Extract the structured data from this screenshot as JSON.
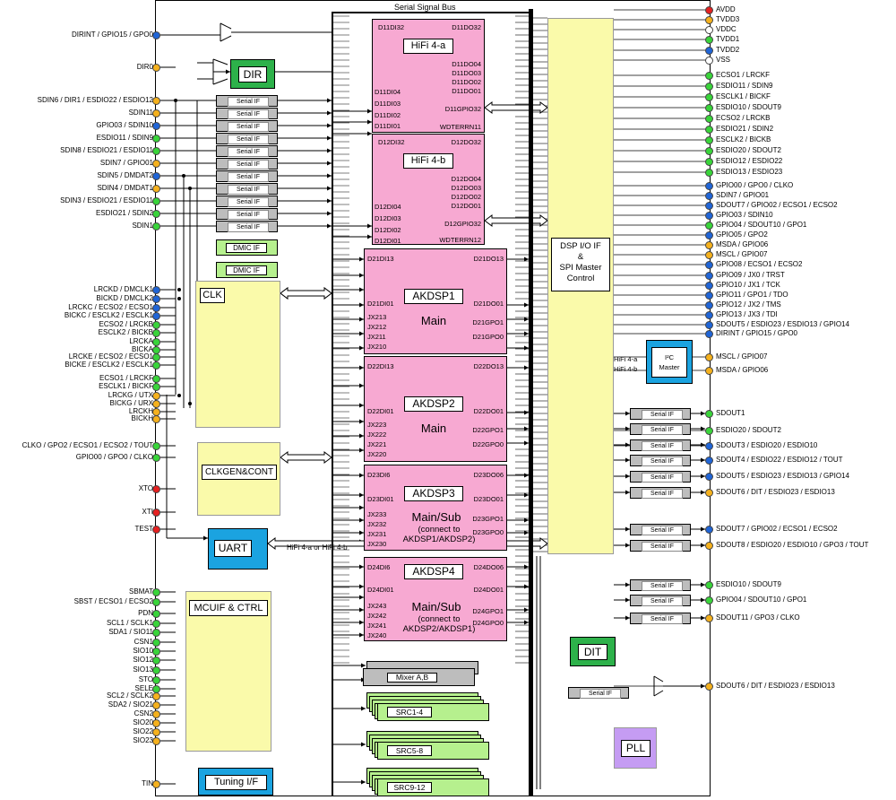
{
  "colors": {
    "hifi": "#f7a9d2",
    "yellow": "#fafaaa",
    "green": "#2db14a",
    "light_green": "#b6f08e",
    "blue": "#1ba3e0",
    "purple": "#c59cf3",
    "gray": "#bdbdbd",
    "pin_green": "#39d43a",
    "pin_blue": "#2065d6",
    "pin_orange": "#f5b11d",
    "pin_red": "#e52121",
    "pin_white": "#ffffff"
  },
  "bus_label": "Serial Signal Bus",
  "blocks": {
    "dir": "DIR",
    "dit": "DIT",
    "clk": "CLK",
    "clkgen": "CLKGEN&CONT",
    "uart": "UART",
    "mcuif": "MCUIF & CTRL",
    "tuning": "Tuning I/F",
    "pll": "PLL",
    "dsp_io": "DSP I/O IF\n&\nSPI Master\nControl",
    "i2c_master": "I²C\nMaster",
    "mixer": "Mixer A,B",
    "src1": "SRC1-4",
    "src2": "SRC5-8",
    "src3": "SRC9-12",
    "dmic_if": "DMIC IF",
    "serial_if": "Serial IF",
    "hifi_label": "HiFi 4-a\nHiFi 4-b",
    "uart_bus_label": "HiFi 4-a or HiFi 4-b"
  },
  "hifi_a": {
    "title": "HiFi 4-a",
    "di_top": "D11DI32",
    "do_top": "D11DO32",
    "di": [
      "D11DI04",
      "D11DI03",
      "D11DI02",
      "D11DI01"
    ],
    "do": [
      "D11DO04",
      "D11DO03",
      "D11DO02",
      "D11DO01"
    ],
    "gpio": "D11GPIO32",
    "wdt": "WDTERRN11"
  },
  "hifi_b": {
    "title": "HiFi 4-b",
    "di_top": "D12DI32",
    "do_top": "D12DO32",
    "di": [
      "D12DI04",
      "D12DI03",
      "D12DI02",
      "D12DI01"
    ],
    "do": [
      "D12DO04",
      "D12DO03",
      "D12DO02",
      "D12DO01"
    ],
    "gpio": "D12GPIO32",
    "wdt": "WDTERRN12"
  },
  "dsp1": {
    "title": "AKDSP1",
    "mode": "Main",
    "sub": "",
    "di_top": "D21DI13",
    "do_top": "D21DO13",
    "di1": "D21DI01",
    "do1": "D21DO01",
    "jx": [
      "JX213",
      "JX212",
      "JX211",
      "JX210"
    ],
    "gpo": [
      "D21GPO1",
      "D21GPO0"
    ]
  },
  "dsp2": {
    "title": "AKDSP2",
    "mode": "Main",
    "sub": "",
    "di_top": "D22DI13",
    "do_top": "D22DO13",
    "di1": "D22DI01",
    "do1": "D22DO01",
    "jx": [
      "JX223",
      "JX222",
      "JX221",
      "JX220"
    ],
    "gpo": [
      "D22GPO1",
      "D22GPO0"
    ]
  },
  "dsp3": {
    "title": "AKDSP3",
    "mode": "Main/Sub",
    "sub": "(connect to\nAKDSP1/AKDSP2)",
    "di_top": "D23DI6",
    "do_top": "D23DO06",
    "di1": "D23DI01",
    "do1": "D23DO01",
    "jx": [
      "JX233",
      "JX232",
      "JX231",
      "JX230"
    ],
    "gpo": [
      "D23GPO1",
      "D23GPO0"
    ]
  },
  "dsp4": {
    "title": "AKDSP4",
    "mode": "Main/Sub",
    "sub": "(connect to\nAKDSP2/AKDSP1)",
    "di_top": "D24DI6",
    "do_top": "D24DO06",
    "di1": "D24DI01",
    "do1": "D24DO01",
    "jx": [
      "JX243",
      "JX242",
      "JX241",
      "JX240"
    ],
    "gpo": [
      "D24GPO1",
      "D24GPO0"
    ]
  },
  "left_pins": [
    {
      "label": "DIRINT / GPIO15 / GPO0",
      "color": "blue"
    },
    {
      "label": "DIR0",
      "color": "orange"
    },
    {
      "label": "SDIN6 / DIR1 / ESDIO22 / ESDIO12",
      "color": "orange"
    },
    {
      "label": "SDIN11",
      "color": "orange"
    },
    {
      "label": "GPIO03 / SDIN10",
      "color": "blue"
    },
    {
      "label": "ESDIO11 / SDIN9",
      "color": "green"
    },
    {
      "label": "SDIN8 / ESDIO21 / ESDIO11",
      "color": "green"
    },
    {
      "label": "SDIN7 / GPIO01",
      "color": "orange"
    },
    {
      "label": "SDIN5 / DMDAT2",
      "color": "blue"
    },
    {
      "label": "SDIN4 / DMDAT1",
      "color": "orange"
    },
    {
      "label": "SDIN3 / ESDIO21 / ESDIO11",
      "color": "green"
    },
    {
      "label": "ESDIO21 / SDIN2",
      "color": "green"
    },
    {
      "label": "SDIN1",
      "color": "green"
    },
    {
      "label": "LRCKD / DMCLK1",
      "color": "blue"
    },
    {
      "label": "BICKD / DMCLK2",
      "color": "blue"
    },
    {
      "label": "LRCKC / ECSO2 / ECSO1",
      "color": "blue"
    },
    {
      "label": "BICKC / ESCLK2 / ESCLK1",
      "color": "blue"
    },
    {
      "label": "ECSO2 / LRCKB",
      "color": "green"
    },
    {
      "label": "ESCLK2 / BICKB",
      "color": "green"
    },
    {
      "label": "LRCKA",
      "color": "green"
    },
    {
      "label": "BICKA",
      "color": "green"
    },
    {
      "label": "LRCKE / ECSO2 / ECSO1",
      "color": "green"
    },
    {
      "label": "BICKE / ESCLK2 / ESCLK1",
      "color": "green"
    },
    {
      "label": "ECSO1 / LRCKF",
      "color": "green"
    },
    {
      "label": "ESCLK1 / BICKF",
      "color": "green"
    },
    {
      "label": "LRCKG / UTX",
      "color": "orange"
    },
    {
      "label": "BICKG / URX",
      "color": "orange"
    },
    {
      "label": "LRCKH",
      "color": "orange"
    },
    {
      "label": "BICKH",
      "color": "orange"
    },
    {
      "label": "CLKO / GPO2 / ECSO1 / ECSO2 / TOUT",
      "color": "green"
    },
    {
      "label": "GPIO00 / GPO0 / CLKO",
      "color": "green"
    },
    {
      "label": "XTO",
      "color": "red"
    },
    {
      "label": "XTI",
      "color": "red"
    },
    {
      "label": "TEST",
      "color": "red"
    },
    {
      "label": "SBMAT",
      "color": "green"
    },
    {
      "label": "SBST / ECSO1 / ECSO2",
      "color": "green"
    },
    {
      "label": "PDN",
      "color": "green"
    },
    {
      "label": "SCL1 / SCLK1",
      "color": "green"
    },
    {
      "label": "SDA1 / SIO11",
      "color": "green"
    },
    {
      "label": "CSN1",
      "color": "green"
    },
    {
      "label": "SIO10",
      "color": "green"
    },
    {
      "label": "SIO12",
      "color": "green"
    },
    {
      "label": "SIO13",
      "color": "green"
    },
    {
      "label": "STO",
      "color": "green"
    },
    {
      "label": "SELE",
      "color": "green"
    },
    {
      "label": "SCL2 / SCLK2",
      "color": "orange"
    },
    {
      "label": "SDA2 / SIO21",
      "color": "orange"
    },
    {
      "label": "CSN2",
      "color": "orange"
    },
    {
      "label": "SIO20",
      "color": "orange"
    },
    {
      "label": "SIO22",
      "color": "orange"
    },
    {
      "label": "SIO23",
      "color": "orange"
    },
    {
      "label": "TIN",
      "color": "orange"
    }
  ],
  "right_pins": [
    {
      "label": "AVDD",
      "color": "red"
    },
    {
      "label": "TVDD3",
      "color": "orange"
    },
    {
      "label": "VDDC",
      "color": "white"
    },
    {
      "label": "TVDD1",
      "color": "green"
    },
    {
      "label": "TVDD2",
      "color": "blue"
    },
    {
      "label": "VSS",
      "color": "white"
    },
    {
      "label": "ECSO1 / LRCKF",
      "color": "green"
    },
    {
      "label": "ESDIO11 / SDIN9",
      "color": "green"
    },
    {
      "label": "ESCLK1 / BICKF",
      "color": "green"
    },
    {
      "label": "ESDIO10 / SDOUT9",
      "color": "green"
    },
    {
      "label": "ECSO2 / LRCKB",
      "color": "green"
    },
    {
      "label": "ESDIO21 / SDIN2",
      "color": "green"
    },
    {
      "label": "ESCLK2 / BICKB",
      "color": "green"
    },
    {
      "label": "ESDIO20 / SDOUT2",
      "color": "green"
    },
    {
      "label": "ESDIO12 / ESDIO22",
      "color": "green"
    },
    {
      "label": "ESDIO13 / ESDIO23",
      "color": "green"
    },
    {
      "label": "GPIO00 / GPO0 / CLKO",
      "color": "blue"
    },
    {
      "label": "SDIN7 / GPIO01",
      "color": "blue"
    },
    {
      "label": "SDOUT7 / GPIO02 / ECSO1 / ECSO2",
      "color": "blue"
    },
    {
      "label": "GPIO03 / SDIN10",
      "color": "blue"
    },
    {
      "label": "GPIO04 / SDOUT10 / GPO1",
      "color": "green"
    },
    {
      "label": "GPIO05 / GPO2",
      "color": "blue"
    },
    {
      "label": "MSDA / GPIO06",
      "color": "orange"
    },
    {
      "label": "MSCL / GPIO07",
      "color": "orange"
    },
    {
      "label": "GPIO08 / ECSO1 / ECSO2",
      "color": "blue"
    },
    {
      "label": "GPIO09 / JX0 / TRST",
      "color": "blue"
    },
    {
      "label": "GPIO10 / JX1 / TCK",
      "color": "blue"
    },
    {
      "label": "GPIO11 / GPO1 / TDO",
      "color": "blue"
    },
    {
      "label": "GPIO12 / JX2 / TMS",
      "color": "blue"
    },
    {
      "label": "GPIO13 / JX3 / TDI",
      "color": "blue"
    },
    {
      "label": "SDOUT5 / ESDIO23 / ESDIO13 / GPIO14",
      "color": "blue"
    },
    {
      "label": "DIRINT / GPIO15 / GPO0",
      "color": "blue"
    },
    {
      "label": "MSCL / GPIO07",
      "color": "orange"
    },
    {
      "label": "MSDA / GPIO06",
      "color": "orange"
    },
    {
      "label": "SDOUT1",
      "color": "green"
    },
    {
      "label": "ESDIO20 / SDOUT2",
      "color": "green"
    },
    {
      "label": "SDOUT3 / ESDIO20 / ESDIO10",
      "color": "blue"
    },
    {
      "label": "SDOUT4 / ESDIO22 / ESDIO12 / TOUT",
      "color": "blue"
    },
    {
      "label": "SDOUT5 / ESDIO23 / ESDIO13 / GPIO14",
      "color": "blue"
    },
    {
      "label": "SDOUT6 / DIT / ESDIO23 / ESDIO13",
      "color": "orange"
    },
    {
      "label": "SDOUT7 / GPIO02 / ECSO1 / ECSO2",
      "color": "blue"
    },
    {
      "label": "SDOUT8 / ESDIO20 / ESDIO10 / GPO3 / TOUT",
      "color": "orange"
    },
    {
      "label": "ESDIO10 / SDOUT9",
      "color": "green"
    },
    {
      "label": "GPIO04 / SDOUT10 / GPO1",
      "color": "green"
    },
    {
      "label": "SDOUT11 / GPO3 / CLKO",
      "color": "orange"
    },
    {
      "label": "SDOUT6 / DIT / ESDIO23 / ESDIO13",
      "color": "orange"
    }
  ]
}
